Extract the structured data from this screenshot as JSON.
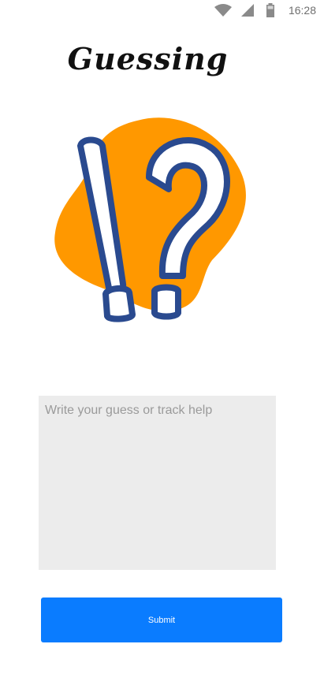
{
  "status_bar": {
    "time": "16:28",
    "icons": [
      "wifi-icon",
      "cell-signal-icon",
      "battery-icon"
    ]
  },
  "header": {
    "title": "Guessing"
  },
  "illustration": {
    "name": "exclamation-question-illustration",
    "colors": {
      "blob": "#ff9800",
      "marks": "#2a4a8f",
      "fill": "#ffffff"
    }
  },
  "guess": {
    "placeholder": "Write your guess or track help",
    "value": ""
  },
  "submit": {
    "label": "Submit"
  },
  "colors": {
    "accent": "#0a7cff",
    "input_bg": "#ececec"
  }
}
